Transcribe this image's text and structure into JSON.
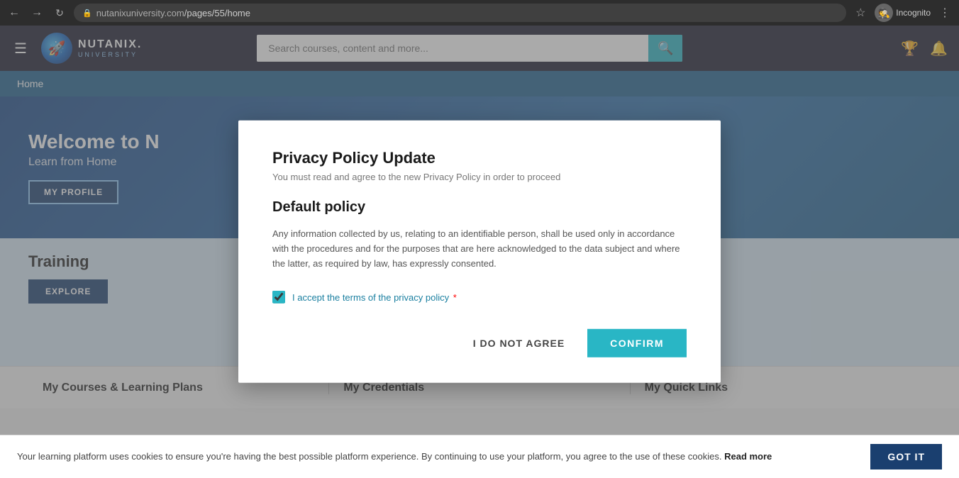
{
  "browser": {
    "url": "nutanixuniversity.com/pages/55/home",
    "url_prefix": "nutanixuniversity.com",
    "url_path": "/pages/55/home",
    "incognito_label": "Incognito"
  },
  "header": {
    "logo_main": "NUTANIX.",
    "logo_sub": "UNIVERSITY",
    "search_placeholder": "Search courses, content and more...",
    "nav_home": "Home"
  },
  "hero": {
    "title": "Welcome to N",
    "subtitle": "Learn from Home",
    "my_profile_label": "MY PROFILE"
  },
  "training": {
    "title": "Training",
    "explore_label": "EXPLORE"
  },
  "bottom": {
    "courses_label": "My Courses & Learning Plans",
    "credentials_label": "My Credentials",
    "quick_links_label": "My Quick Links"
  },
  "modal": {
    "title": "Privacy Policy Update",
    "subtitle": "You must read and agree to the new Privacy Policy in order to proceed",
    "policy_title": "Default policy",
    "policy_text": "Any information collected by us, relating to an identifiable person, shall be used only in accordance with the procedures and for the purposes that are here acknowledged to the data subject and where the latter, as required by law, has expressly consented.",
    "checkbox_label": "I accept the terms of the privacy policy",
    "checkbox_checked": true,
    "do_not_agree_label": "I DO NOT AGREE",
    "confirm_label": "CONFIRM"
  },
  "cookie": {
    "text": "Your learning platform uses cookies to ensure you're having the best possible platform experience. By continuing to use your platform, you agree to the use of these cookies.",
    "read_more_label": "Read more",
    "got_it_label": "GOT IT"
  }
}
